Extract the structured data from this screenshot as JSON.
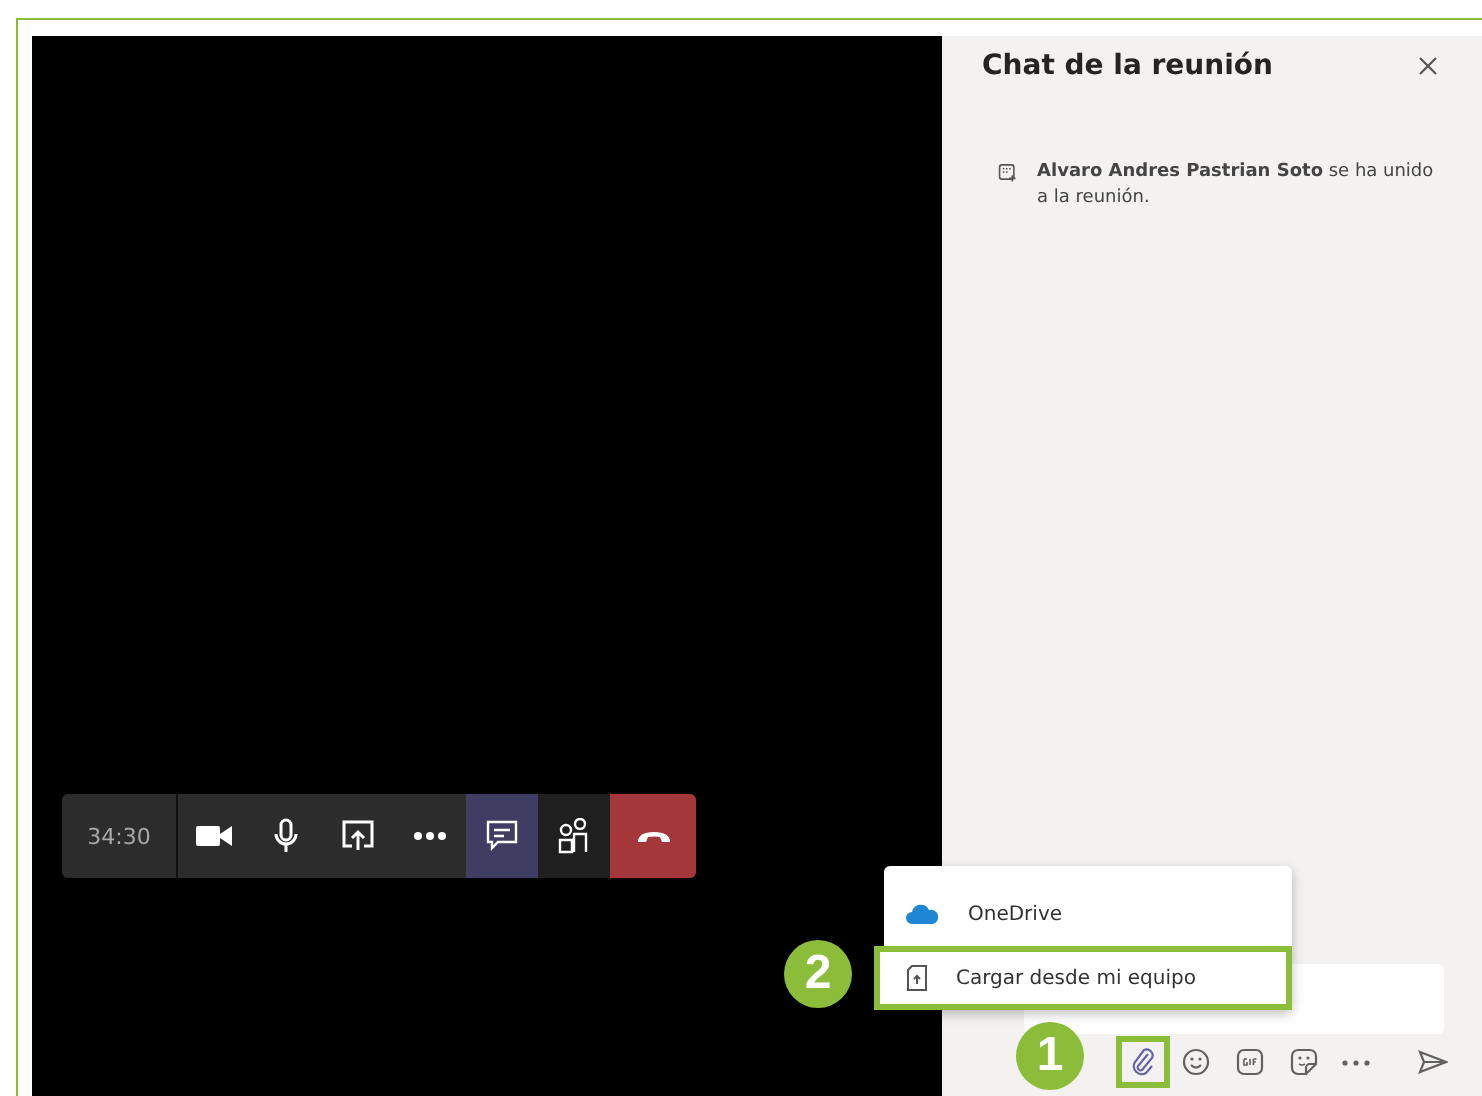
{
  "chat": {
    "title": "Chat de la reunión",
    "messages": [
      {
        "text": "**Alvaro Andres Pastrian Soto** se ha unido a la reunión."
      }
    ]
  },
  "call_bar": {
    "timer": "34:30",
    "buttons": [
      {
        "kind": "video",
        "selected": false
      },
      {
        "kind": "mic",
        "selected": false
      },
      {
        "kind": "share",
        "selected": false
      },
      {
        "kind": "more",
        "selected": false
      },
      {
        "kind": "chat",
        "selected": true
      },
      {
        "kind": "people",
        "selected": false
      },
      {
        "kind": "hangup"
      }
    ]
  },
  "attach_menu": {
    "items": [
      {
        "kind": "onedrive",
        "label": "OneDrive"
      },
      {
        "kind": "upload",
        "label": "Cargar desde mi equipo",
        "callout": "2"
      }
    ]
  },
  "compose_tools": [
    {
      "kind": "attach",
      "callout": "1"
    },
    {
      "kind": "emoji"
    },
    {
      "kind": "gif"
    },
    {
      "kind": "sticker"
    },
    {
      "kind": "more"
    },
    {
      "kind": "send"
    }
  ]
}
